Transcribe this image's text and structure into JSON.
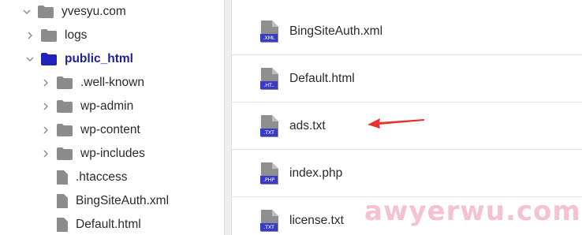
{
  "tree": {
    "items": [
      {
        "label": "yvesyu.com",
        "type": "folder",
        "expanded": true,
        "active": false
      },
      {
        "label": "logs",
        "type": "folder",
        "expanded": false,
        "active": false
      },
      {
        "label": "public_html",
        "type": "folder",
        "expanded": true,
        "active": true
      },
      {
        "label": ".well-known",
        "type": "folder",
        "expanded": false,
        "active": false
      },
      {
        "label": "wp-admin",
        "type": "folder",
        "expanded": false,
        "active": false
      },
      {
        "label": "wp-content",
        "type": "folder",
        "expanded": false,
        "active": false
      },
      {
        "label": "wp-includes",
        "type": "folder",
        "expanded": false,
        "active": false
      },
      {
        "label": ".htaccess",
        "type": "file",
        "active": false
      },
      {
        "label": "BingSiteAuth.xml",
        "type": "file",
        "active": false
      },
      {
        "label": "Default.html",
        "type": "file",
        "active": false
      }
    ]
  },
  "files": [
    {
      "name": "BingSiteAuth.xml",
      "ext": ".XML"
    },
    {
      "name": "Default.html",
      "ext": ".HT.."
    },
    {
      "name": "ads.txt",
      "ext": ".TXT"
    },
    {
      "name": "index.php",
      "ext": ".PHP"
    },
    {
      "name": "license.txt",
      "ext": ".TXT"
    }
  ],
  "watermark": "awyerwu.com",
  "colors": {
    "active_folder": "#1f1f9a",
    "folder": "#8c8c8c",
    "ext_badge": "#3a3ac4",
    "arrow": "#e8322e"
  }
}
